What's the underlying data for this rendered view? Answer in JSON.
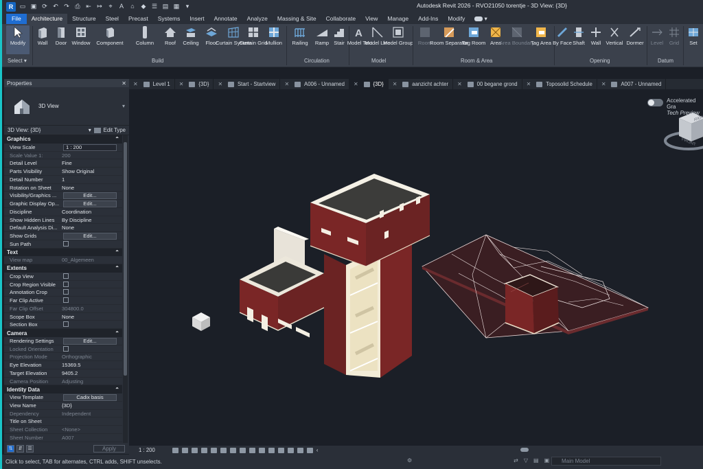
{
  "window": {
    "title": "Autodesk Revit 2026 - RVO21050 torentje - 3D View: {3D}"
  },
  "ribbon": {
    "tabs": [
      "File",
      "Architecture",
      "Structure",
      "Steel",
      "Precast",
      "Systems",
      "Insert",
      "Annotate",
      "Analyze",
      "Massing & Site",
      "Collaborate",
      "View",
      "Manage",
      "Add-Ins",
      "Modify"
    ],
    "active_tab": "Architecture",
    "tools": {
      "modify": "Modify",
      "wall": "Wall",
      "door": "Door",
      "window": "Window",
      "component": "Component",
      "column": "Column",
      "roof": "Roof",
      "ceiling": "Ceiling",
      "floor": "Floor",
      "curtain_system": "Curtain System",
      "curtain_grid": "Curtain Grid",
      "mullion": "Mullion",
      "railing": "Railing",
      "ramp": "Ramp",
      "stair": "Stair",
      "model_text": "Model Text",
      "model_line": "Model Line",
      "model_group": "Model Group",
      "room": "Room",
      "room_separator": "Room Separator",
      "tag_room": "Tag Room",
      "area": "Area",
      "area_boundary": "Area Boundary",
      "tag_area": "Tag Area",
      "by_face": "By Face",
      "shaft": "Shaft",
      "wall_opening": "Wall",
      "vertical": "Vertical",
      "dormer": "Dormer",
      "level": "Level",
      "grid": "Grid",
      "set": "Set"
    },
    "panels": {
      "select": "Select",
      "build": "Build",
      "circulation": "Circulation",
      "model": "Model",
      "room_area": "Room & Area",
      "opening": "Opening",
      "datum": "Datum"
    }
  },
  "properties": {
    "title": "Properties",
    "type_name": "3D View",
    "instance_label": "3D View: {3D}",
    "edit_type": "Edit Type",
    "sections": [
      {
        "name": "Graphics",
        "rows": [
          {
            "k": "View Scale",
            "v": "1 : 200",
            "kind": "input"
          },
          {
            "k": "Scale Value    1:",
            "v": "200",
            "kind": "dim"
          },
          {
            "k": "Detail Level",
            "v": "Fine"
          },
          {
            "k": "Parts Visibility",
            "v": "Show Original"
          },
          {
            "k": "Detail Number",
            "v": "1"
          },
          {
            "k": "Rotation on Sheet",
            "v": "None"
          },
          {
            "k": "Visibility/Graphics ...",
            "v": "Edit...",
            "kind": "button"
          },
          {
            "k": "Graphic Display Op...",
            "v": "Edit...",
            "kind": "button"
          },
          {
            "k": "Discipline",
            "v": "Coordination"
          },
          {
            "k": "Show Hidden Lines",
            "v": "By Discipline"
          },
          {
            "k": "Default Analysis Di...",
            "v": "None"
          },
          {
            "k": "Show Grids",
            "v": "Edit...",
            "kind": "button"
          },
          {
            "k": "Sun Path",
            "v": "",
            "kind": "check"
          }
        ]
      },
      {
        "name": "Text",
        "rows": [
          {
            "k": "View map",
            "v": "00_Algemeen",
            "kind": "dim"
          }
        ]
      },
      {
        "name": "Extents",
        "rows": [
          {
            "k": "Crop View",
            "v": "",
            "kind": "check"
          },
          {
            "k": "Crop Region Visible",
            "v": "",
            "kind": "check"
          },
          {
            "k": "Annotation Crop",
            "v": "",
            "kind": "check"
          },
          {
            "k": "Far Clip Active",
            "v": "",
            "kind": "check"
          },
          {
            "k": "Far Clip Offset",
            "v": "304800.0",
            "kind": "dim"
          },
          {
            "k": "Scope Box",
            "v": "None"
          },
          {
            "k": "Section Box",
            "v": "",
            "kind": "check"
          }
        ]
      },
      {
        "name": "Camera",
        "rows": [
          {
            "k": "Rendering Settings",
            "v": "Edit...",
            "kind": "button"
          },
          {
            "k": "Locked Orientation",
            "v": "",
            "kind": "checkdim"
          },
          {
            "k": "Projection Mode",
            "v": "Orthographic",
            "kind": "dim"
          },
          {
            "k": "Eye Elevation",
            "v": "15369.5"
          },
          {
            "k": "Target Elevation",
            "v": "9405.2"
          },
          {
            "k": "Camera Position",
            "v": "Adjusting",
            "kind": "dim"
          }
        ]
      },
      {
        "name": "Identity Data",
        "rows": [
          {
            "k": "View Template",
            "v": "Cadix basis",
            "kind": "button"
          },
          {
            "k": "View Name",
            "v": "{3D}"
          },
          {
            "k": "Dependency",
            "v": "Independent",
            "kind": "dim"
          },
          {
            "k": "Title on Sheet",
            "v": ""
          },
          {
            "k": "Sheet Collection",
            "v": "<None>",
            "kind": "dim"
          },
          {
            "k": "Sheet Number",
            "v": "A007",
            "kind": "dim"
          }
        ]
      }
    ],
    "apply": "Apply"
  },
  "view_tabs": [
    {
      "label": "Level 1",
      "active": false
    },
    {
      "label": "{3D}",
      "active": false
    },
    {
      "label": "Start - Startview",
      "active": false
    },
    {
      "label": "A006 - Unnamed",
      "active": false
    },
    {
      "label": "{3D}",
      "active": true
    },
    {
      "label": "aanzicht achter",
      "active": false
    },
    {
      "label": "00 begane grond",
      "active": false
    },
    {
      "label": "Toposolid Schedule",
      "active": false
    },
    {
      "label": "A007 - Unnamed",
      "active": false
    }
  ],
  "canvas": {
    "accelerated_line1": "Accelerated Gra",
    "accelerated_line2": "Tech Preview",
    "viewcube_face1": "FRONT",
    "viewcube_face2": "RIGHT"
  },
  "view_control": {
    "scale": "1 : 200"
  },
  "status": {
    "message": "Click to select, TAB for alternates, CTRL adds, SHIFT unselects.",
    "model": "Main Model"
  },
  "colors": {
    "accent": "#1f6dd1",
    "brick": "#7a2626",
    "canvas": "#1b1f27",
    "panel": "#2b3039"
  }
}
